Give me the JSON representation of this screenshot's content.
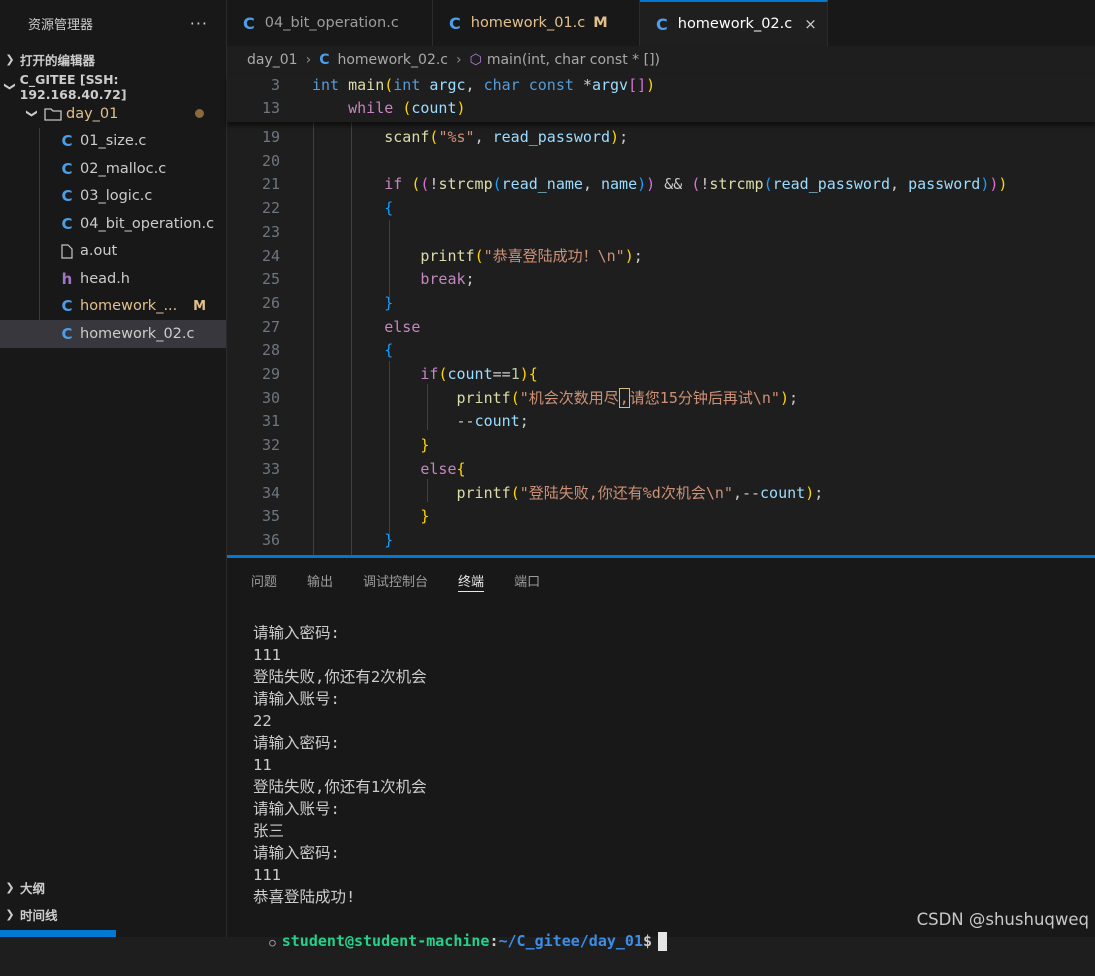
{
  "sidebar": {
    "title": "资源管理器",
    "more": "···",
    "open_editors": "打开的编辑器",
    "workspace": "C_GITEE [SSH: 192.168.40.72]",
    "folder": "day_01",
    "files": [
      {
        "name": "01_size.c",
        "icon": "C"
      },
      {
        "name": "02_malloc.c",
        "icon": "C"
      },
      {
        "name": "03_logic.c",
        "icon": "C"
      },
      {
        "name": "04_bit_operation.c",
        "icon": "C"
      },
      {
        "name": "a.out",
        "icon": "file"
      },
      {
        "name": "head.h",
        "icon": "h"
      },
      {
        "name": "homework_...",
        "icon": "C",
        "badge": "M"
      },
      {
        "name": "homework_02.c",
        "icon": "C"
      }
    ],
    "outline": "大纲",
    "timeline": "时间线"
  },
  "tabs": [
    {
      "label": "04_bit_operation.c"
    },
    {
      "label": "homework_01.c",
      "badge": "M"
    },
    {
      "label": "homework_02.c",
      "close": "×"
    }
  ],
  "breadcrumb": {
    "folder": "day_01",
    "file": "homework_02.c",
    "symbol": "main(int, char const * [])"
  },
  "editor": {
    "sticky": [
      {
        "ln": "3"
      },
      {
        "ln": "13"
      }
    ],
    "lines": [
      "19",
      "20",
      "21",
      "22",
      "23",
      "24",
      "25",
      "26",
      "27",
      "28",
      "29",
      "30",
      "31",
      "32",
      "33",
      "34",
      "35",
      "36"
    ]
  },
  "panel": {
    "tabs": [
      "问题",
      "输出",
      "调试控制台",
      "终端",
      "端口"
    ],
    "active_tab": "终端",
    "terminal": [
      "请输入密码:",
      "111",
      "登陆失败,你还有2次机会",
      "请输入账号:",
      "22",
      "请输入密码:",
      "11",
      "登陆失败,你还有1次机会",
      "请输入账号:",
      "张三",
      "请输入密码:",
      "111",
      "恭喜登陆成功!"
    ],
    "prompt_user": "student@student-machine",
    "prompt_path": "~/C_gitee/day_01",
    "prompt_sym": "$"
  },
  "watermark": "CSDN @shushuqweq"
}
